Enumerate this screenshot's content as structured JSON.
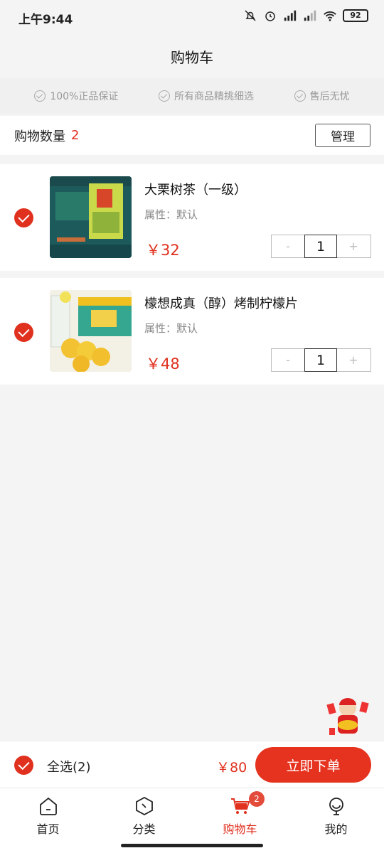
{
  "status_bar": {
    "time": "上午9:44",
    "battery": "92"
  },
  "header": {
    "title": "购物车"
  },
  "guarantees": [
    "100%正品保证",
    "所有商品精挑细选",
    "售后无忧"
  ],
  "cart_summary": {
    "label": "购物数量",
    "count": "2",
    "manage_label": "管理"
  },
  "items": [
    {
      "name": "大栗树茶（一级）",
      "attr": "属性：默认",
      "price": "￥32",
      "quantity": "1",
      "minus": "-",
      "plus": "+"
    },
    {
      "name": "檬想成真（醇）烤制柠檬片",
      "attr": "属性：默认",
      "price": "￥48",
      "quantity": "1",
      "minus": "-",
      "plus": "+"
    }
  ],
  "checkout": {
    "select_all_label": "全选(2)",
    "total": "￥80",
    "order_label": "立即下单"
  },
  "tabbar": [
    {
      "label": "首页",
      "icon": "home-icon"
    },
    {
      "label": "分类",
      "icon": "category-icon"
    },
    {
      "label": "购物车",
      "icon": "cart-icon",
      "badge": "2"
    },
    {
      "label": "我的",
      "icon": "profile-icon"
    }
  ],
  "colors": {
    "accent": "#e0301e",
    "button": "#e6331f",
    "background": "#f4f4f4"
  }
}
